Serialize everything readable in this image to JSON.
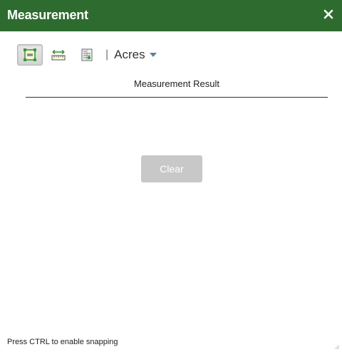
{
  "window": {
    "title": "Measurement",
    "close_icon": "close-icon"
  },
  "toolbar": {
    "tools": [
      {
        "name": "area-tool",
        "icon": "area-measure-icon",
        "active": true
      },
      {
        "name": "distance-tool",
        "icon": "distance-measure-icon",
        "active": false
      },
      {
        "name": "location-tool",
        "icon": "location-measure-icon",
        "active": false
      }
    ],
    "separator": "|",
    "unit_label": "Acres"
  },
  "result": {
    "label": "Measurement Result"
  },
  "actions": {
    "clear_label": "Clear"
  },
  "footer": {
    "hint": "Press CTRL to enable snapping"
  },
  "colors": {
    "titlebar": "#2e6b2f",
    "clear_disabled": "#c8c8c8",
    "icon_green": "#3c9a3c",
    "caret": "#5b7fa8"
  }
}
